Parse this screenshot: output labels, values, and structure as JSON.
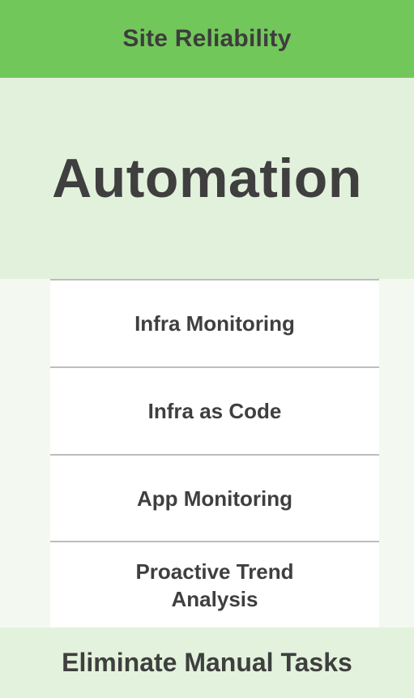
{
  "header": {
    "title": "Site Reliability"
  },
  "hero": {
    "title": "Automation"
  },
  "list": {
    "items": [
      {
        "label": "Infra Monitoring"
      },
      {
        "label": "Infra as Code"
      },
      {
        "label": "App Monitoring"
      },
      {
        "label": "Proactive Trend\nAnalysis"
      }
    ]
  },
  "footer": {
    "text": "Eliminate Manual Tasks"
  },
  "colors": {
    "header_green": "#72c75a",
    "light_green": "#e2f1db",
    "text_dark": "#3f3f3f",
    "separator_gray": "#bdbdbd"
  }
}
